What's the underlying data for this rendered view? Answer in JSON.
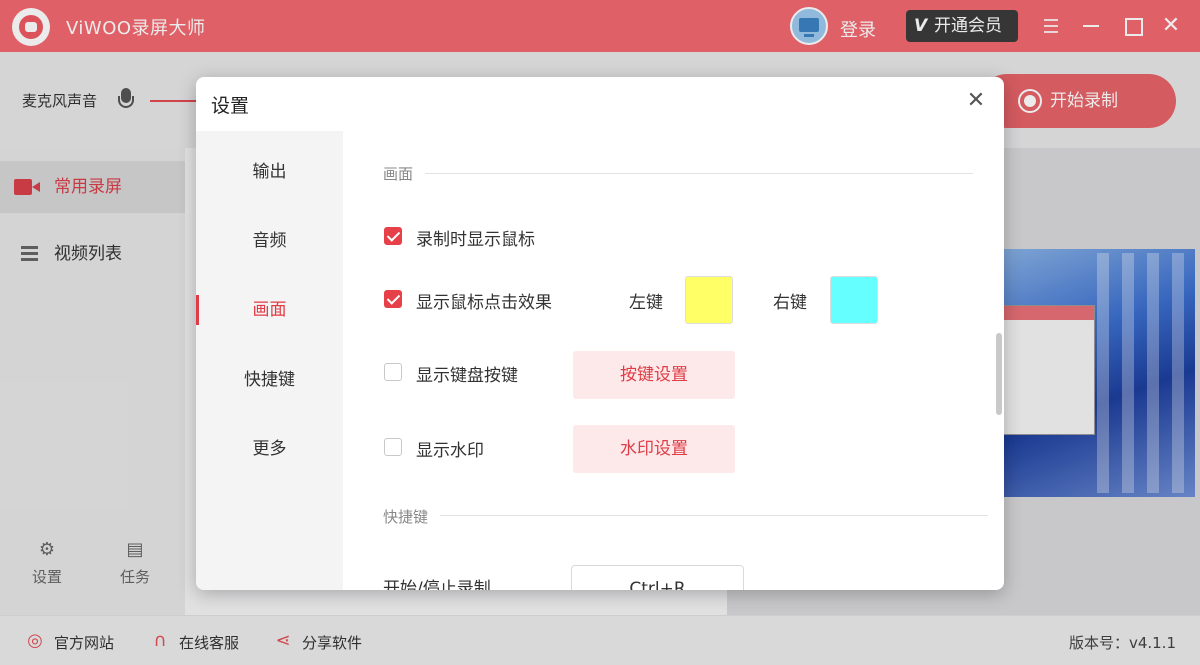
{
  "app": {
    "title": "ViWOO录屏大师"
  },
  "header": {
    "login_label": "登录",
    "vip_label": "开通会员",
    "vip_v": "V"
  },
  "toolbar": {
    "mic_label": "麦克风声音",
    "record_label": "开始录制"
  },
  "sidebar": {
    "items": [
      {
        "label": "常用录屏",
        "icon": "video-camera-icon"
      },
      {
        "label": "视频列表",
        "icon": "list-icon"
      }
    ],
    "settings_label": "设置",
    "tasks_label": "任务"
  },
  "footer": {
    "website_label": "官方网站",
    "support_label": "在线客服",
    "share_label": "分享软件",
    "version": "版本号：v4.1.1"
  },
  "dialog": {
    "title": "设置",
    "nav": [
      "输出",
      "音频",
      "画面",
      "快捷键",
      "更多"
    ],
    "active_nav": "画面",
    "sections": {
      "picture": "画面",
      "hotkeys": "快捷键"
    },
    "options": {
      "show_cursor": {
        "label": "录制时显示鼠标",
        "checked": true
      },
      "click_effect": {
        "label": "显示鼠标点击效果",
        "checked": true
      },
      "show_keys": {
        "label": "显示键盘按键",
        "checked": false
      },
      "watermark": {
        "label": "显示水印",
        "checked": false
      }
    },
    "left_key_label": "左键",
    "right_key_label": "右键",
    "left_key_color": "#ffff66",
    "right_key_color": "#66ffff",
    "key_settings_label": "按键设置",
    "watermark_settings_label": "水印设置",
    "hotkey_start_stop_label": "开始/停止录制",
    "hotkey_start_stop_value": "Ctrl+R"
  },
  "colors": {
    "brand": "#f36970",
    "accent": "#e03c45"
  }
}
